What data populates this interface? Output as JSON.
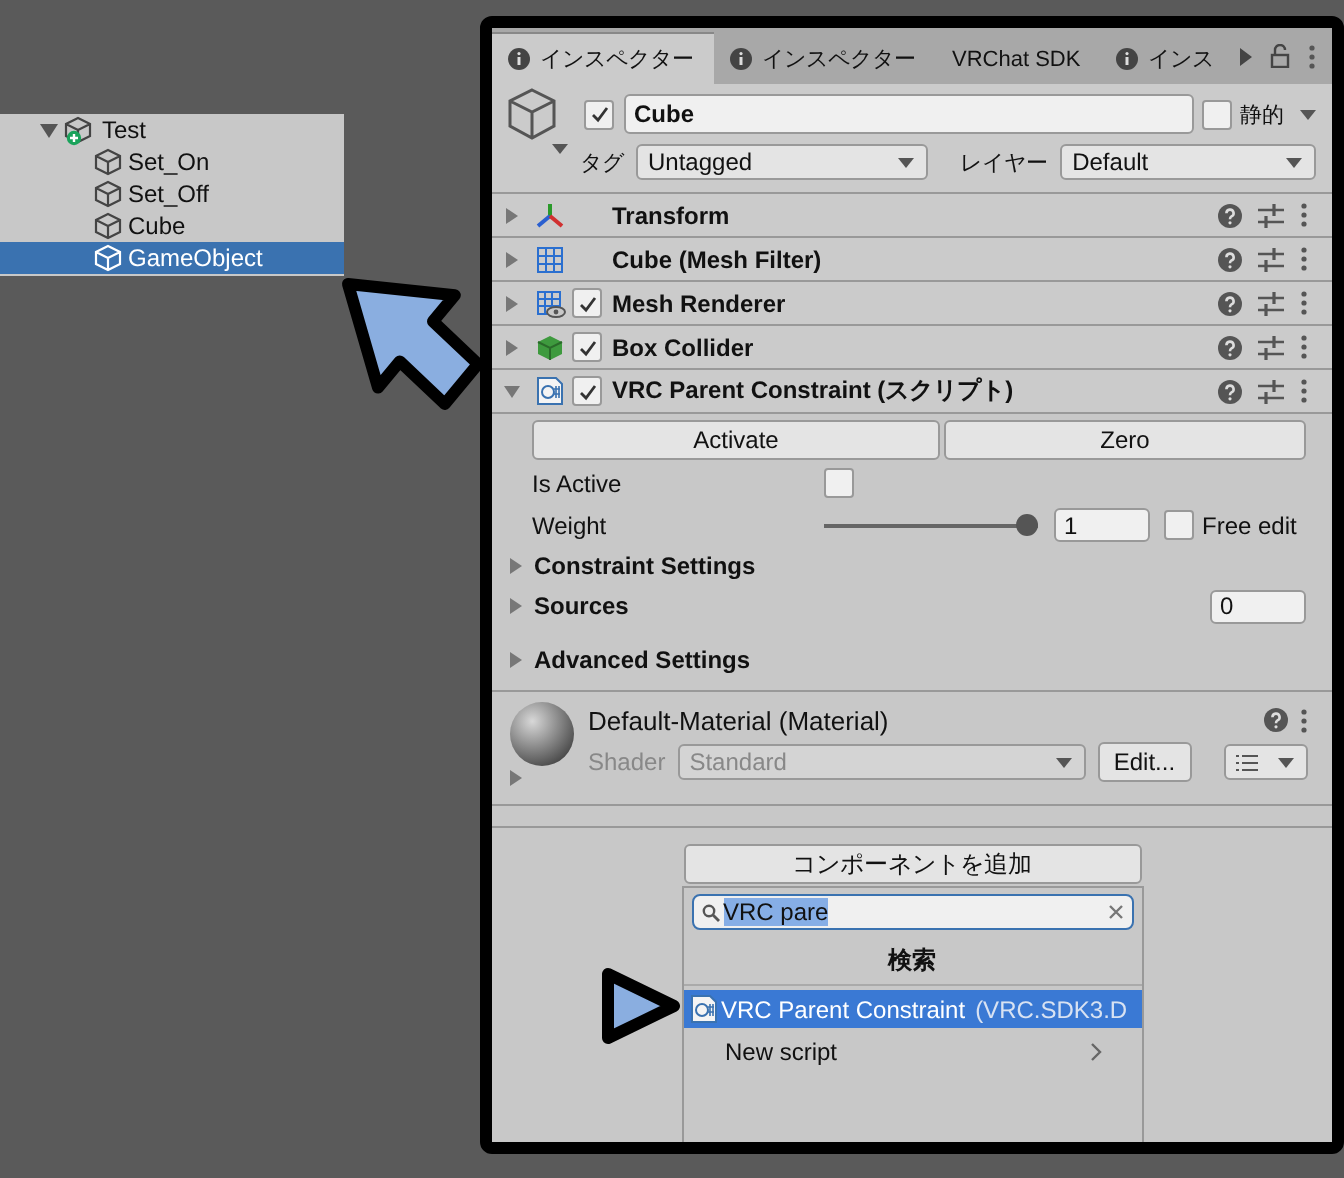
{
  "hierarchy": {
    "items": [
      {
        "label": "Test",
        "expanded": true,
        "selected": false,
        "children": [
          {
            "label": "Set_On",
            "selected": false
          },
          {
            "label": "Set_Off",
            "selected": false
          },
          {
            "label": "Cube",
            "selected": false
          },
          {
            "label": "GameObject",
            "selected": true
          }
        ]
      }
    ]
  },
  "inspector": {
    "tabs": [
      {
        "label": "インスペクター",
        "icon": true,
        "selected": true
      },
      {
        "label": "インスペクター",
        "icon": true,
        "selected": false
      },
      {
        "label": "VRChat SDK",
        "icon": false,
        "selected": false
      },
      {
        "label": "インス",
        "icon": true,
        "selected": false
      }
    ],
    "object": {
      "active": true,
      "name": "Cube",
      "static": false,
      "static_label": "静的",
      "tag_label": "タグ",
      "tag": "Untagged",
      "layer_label": "レイヤー",
      "layer": "Default"
    },
    "components": [
      {
        "name": "Transform",
        "kind": "transform",
        "expanded": false
      },
      {
        "name": "Cube (Mesh Filter)",
        "kind": "mesh-filter",
        "expanded": false
      },
      {
        "name": "Mesh Renderer",
        "kind": "mesh-renderer",
        "enabled": true,
        "expanded": false
      },
      {
        "name": "Box Collider",
        "kind": "box-collider",
        "enabled": true,
        "expanded": false
      },
      {
        "name": "VRC Parent Constraint (スクリプト)",
        "kind": "script",
        "enabled": true,
        "expanded": true
      }
    ],
    "constraint": {
      "buttons": [
        "Activate",
        "Zero"
      ],
      "is_active": {
        "label": "Is Active",
        "checked": false
      },
      "weight": {
        "label": "Weight",
        "level": 1,
        "value": "1",
        "free_edit_label": "Free edit",
        "free_edit": false
      },
      "foldouts": [
        {
          "label": "Constraint Settings",
          "expanded": false
        },
        {
          "label": "Sources",
          "expanded": false,
          "count": "0"
        },
        {
          "label": "Advanced Settings",
          "expanded": false
        }
      ]
    },
    "material": {
      "name": "Default-Material (Material)",
      "shader_label": "Shader",
      "shader": "Standard",
      "edit_button": "Edit...",
      "expanded": false
    },
    "add_component": {
      "button": "コンポーネントを追加",
      "search": "VRC pare",
      "section": "検索",
      "results": [
        {
          "label": "VRC Parent Constraint",
          "detail": "(VRC.SDK3.D",
          "kind": "script",
          "selected": true
        },
        {
          "label": "New script",
          "kind": "submenu",
          "selected": false
        }
      ]
    }
  }
}
